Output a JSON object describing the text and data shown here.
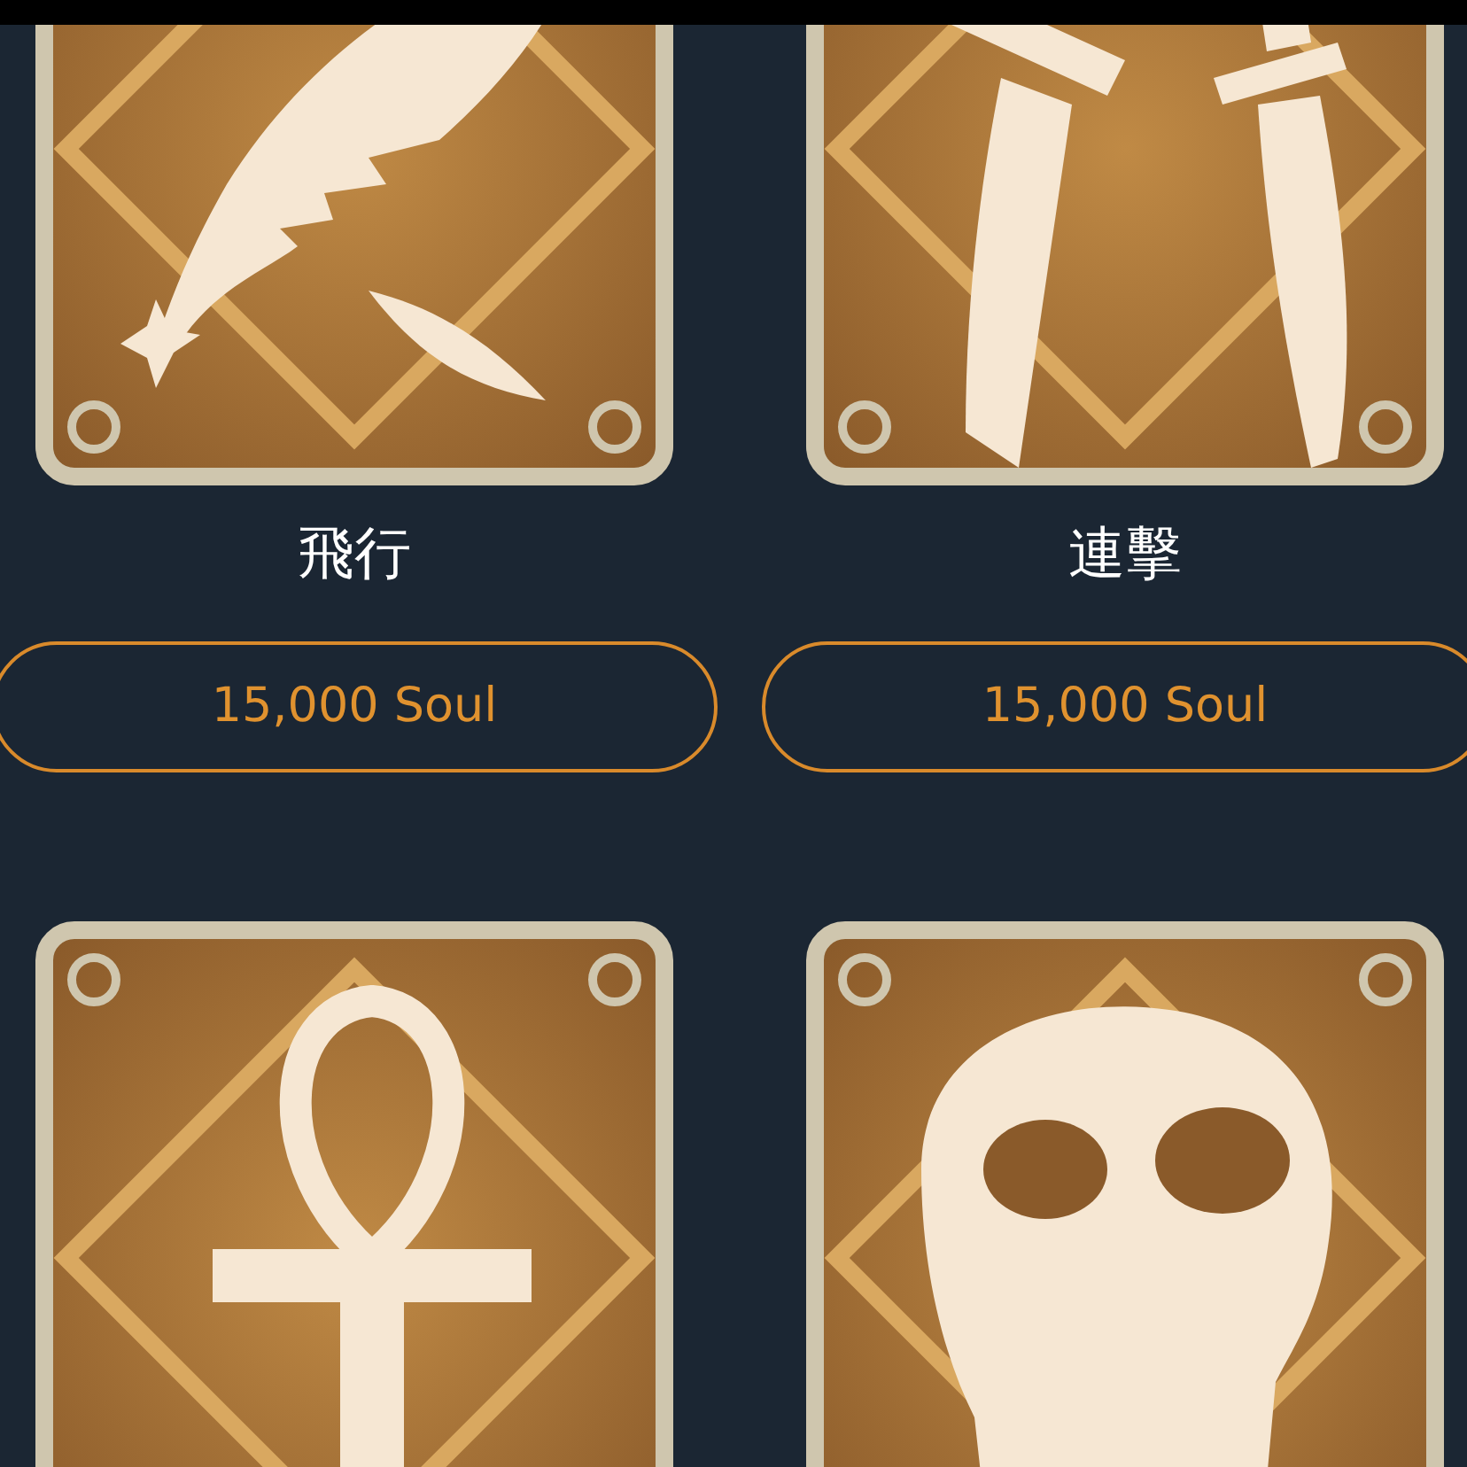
{
  "items": [
    {
      "kind": "feather",
      "name": "飛行",
      "price": "15,000 Soul"
    },
    {
      "kind": "daggers",
      "name": "連擊",
      "price": "15,000 Soul"
    },
    {
      "kind": "ankh"
    },
    {
      "kind": "skull"
    }
  ]
}
